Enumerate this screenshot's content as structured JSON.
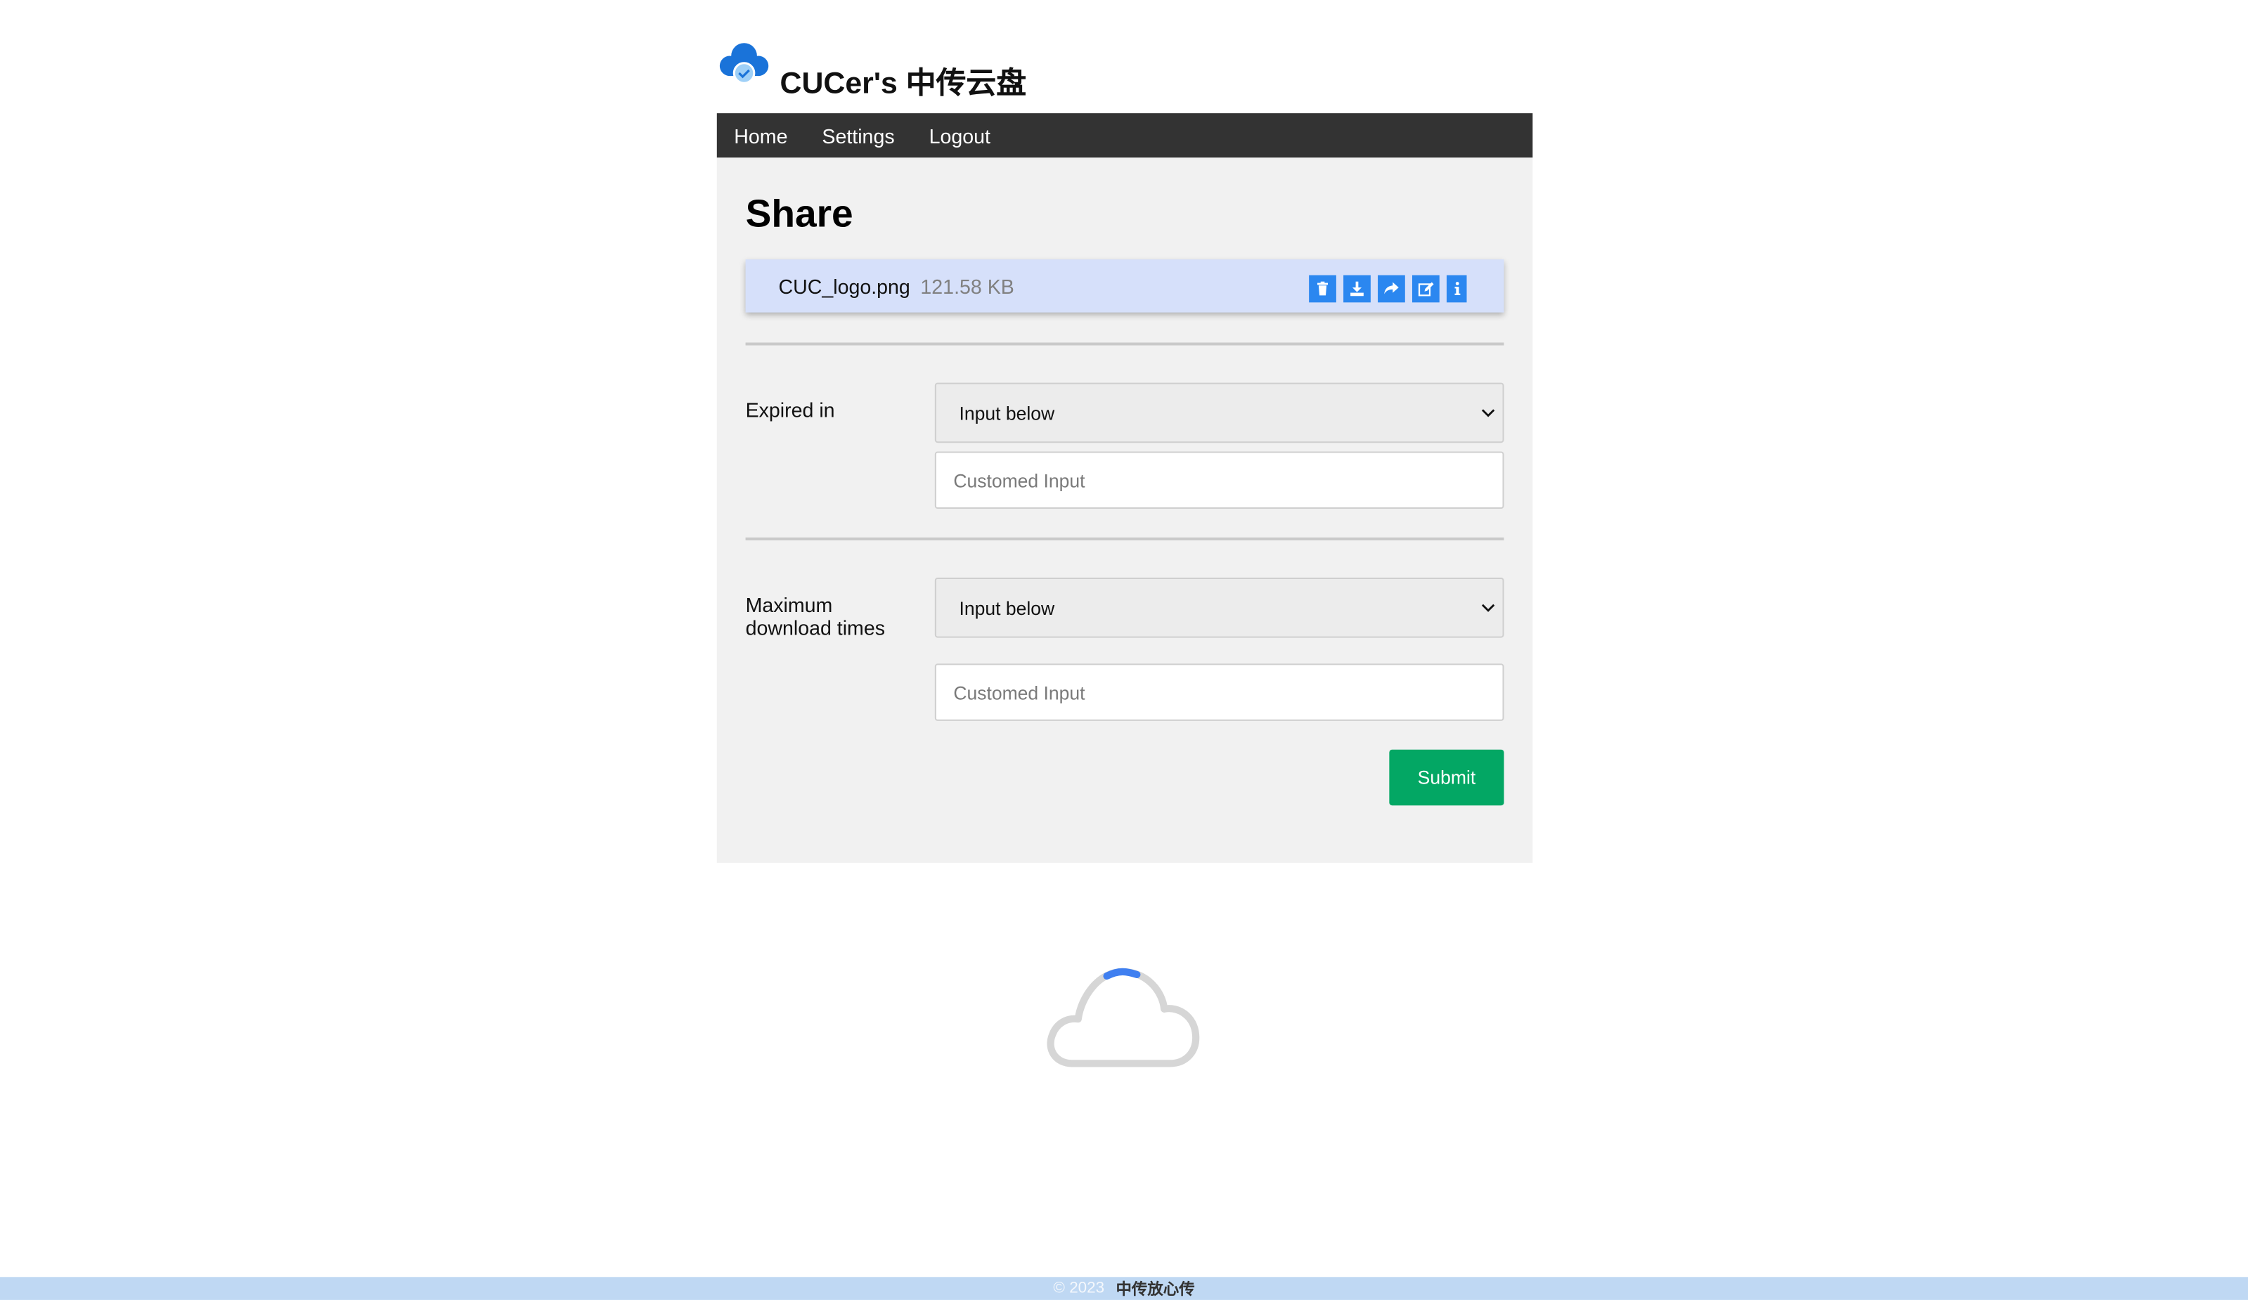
{
  "app": {
    "title": "CUCer's 中传云盘"
  },
  "nav": {
    "items": [
      {
        "label": "Home"
      },
      {
        "label": "Settings"
      },
      {
        "label": "Logout"
      }
    ]
  },
  "share": {
    "title": "Share",
    "file": {
      "name": "CUC_logo.png",
      "size": "121.58 KB"
    },
    "actions": [
      "trash-icon",
      "download-icon",
      "share-icon",
      "edit-icon",
      "info-icon"
    ],
    "expire": {
      "label": "Expired in",
      "selected": "Input below",
      "placeholder": "Customed Input"
    },
    "max_downloads": {
      "label": "Maximum download times",
      "selected": "Input below",
      "placeholder": "Customed Input"
    },
    "submit_label": "Submit"
  },
  "footer": {
    "copyright": "© 2023",
    "brand": "中传放心传"
  },
  "colors": {
    "nav_bg": "#333333",
    "accent_blue": "#2b87f0",
    "submit_green": "#03a764",
    "file_card_bg": "#d6e0fa",
    "footer_bg": "#bfd8f3"
  }
}
